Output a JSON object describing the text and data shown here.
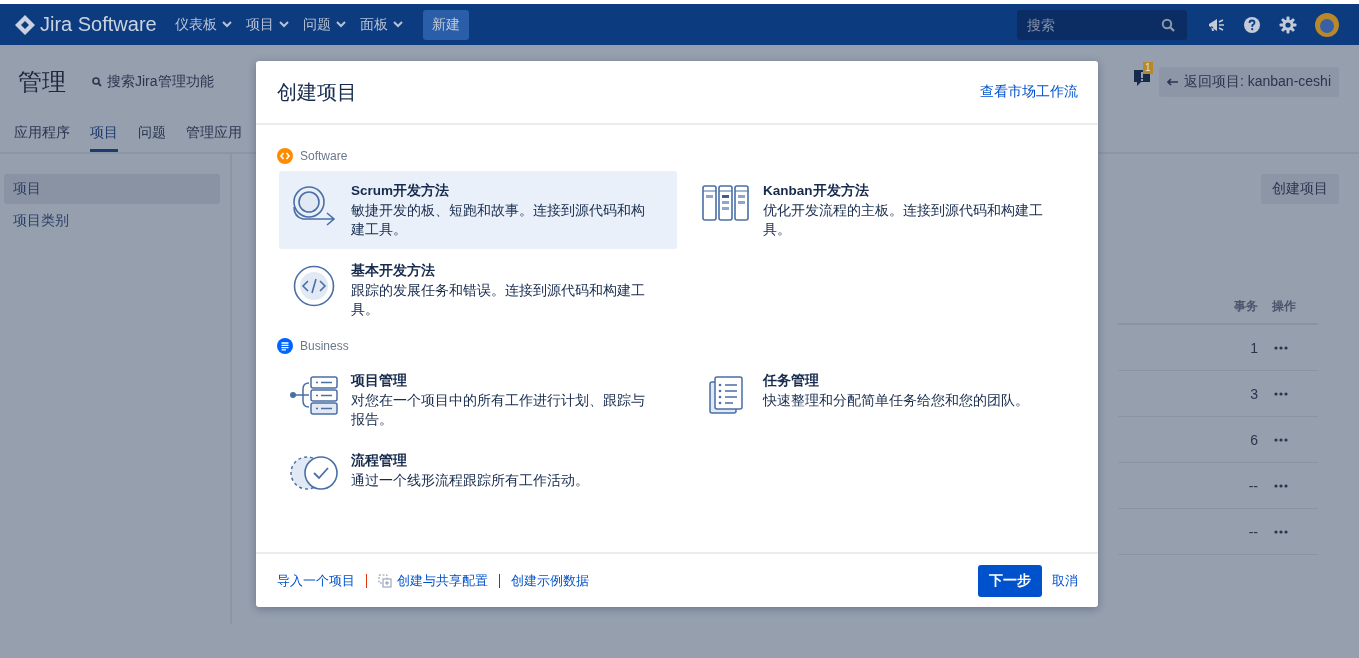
{
  "top_nav": {
    "logo": "Jira Software",
    "menus": [
      {
        "label": "仪表板"
      },
      {
        "label": "项目"
      },
      {
        "label": "问题"
      },
      {
        "label": "面板"
      }
    ],
    "create_button": "新建",
    "search": {
      "placeholder": "搜索"
    }
  },
  "admin": {
    "title": "管理",
    "search_link": "搜索Jira管理功能",
    "tabs": [
      {
        "label": "应用程序",
        "selected": false
      },
      {
        "label": "项目",
        "selected": true
      },
      {
        "label": "问题",
        "selected": false
      },
      {
        "label": "管理应用",
        "selected": false
      }
    ],
    "sidebar": [
      {
        "label": "项目",
        "selected": true
      },
      {
        "label": "项目类别",
        "selected": false
      }
    ],
    "notification_count": "1",
    "back_button": "返回项目: kanban-ceshi",
    "create_project_button": "创建项目",
    "table": {
      "columns": [
        "事务",
        "操作"
      ],
      "rows": [
        {
          "issues": "1"
        },
        {
          "issues": "3"
        },
        {
          "issues": "6"
        },
        {
          "issues": "--"
        },
        {
          "issues": "--"
        }
      ]
    }
  },
  "dialog": {
    "title": "创建项目",
    "marketplace_link": "查看市场工作流",
    "sections": [
      {
        "name": "Software",
        "kind": "software",
        "templates": [
          {
            "kind": "scrum",
            "title": "Scrum开发方法",
            "description": "敏捷开发的板、短跑和故事。连接到源代码和构建工具。",
            "selected": true
          },
          {
            "kind": "kanban",
            "title": "Kanban开发方法",
            "description": "优化开发流程的主板。连接到源代码和构建工具。",
            "selected": false
          },
          {
            "kind": "basic",
            "title": "基本开发方法",
            "description": "跟踪的发展任务和错误。连接到源代码和构建工具。",
            "selected": false
          }
        ]
      },
      {
        "name": "Business",
        "kind": "business",
        "templates": [
          {
            "kind": "project",
            "title": "项目管理",
            "description": "对您在一个项目中的所有工作进行计划、跟踪与报告。",
            "selected": false
          },
          {
            "kind": "task",
            "title": "任务管理",
            "description": "快速整理和分配简单任务给您和您的团队。",
            "selected": false
          },
          {
            "kind": "process",
            "title": "流程管理",
            "description": "通过一个线形流程跟踪所有工作活动。",
            "selected": false
          }
        ]
      }
    ],
    "footer_links": [
      {
        "label": "导入一个项目",
        "kind": "plain"
      },
      {
        "label": "创建与共享配置",
        "kind": "shared"
      },
      {
        "label": "创建示例数据",
        "kind": "plain"
      }
    ],
    "next_button": "下一步",
    "cancel_button": "取消"
  }
}
